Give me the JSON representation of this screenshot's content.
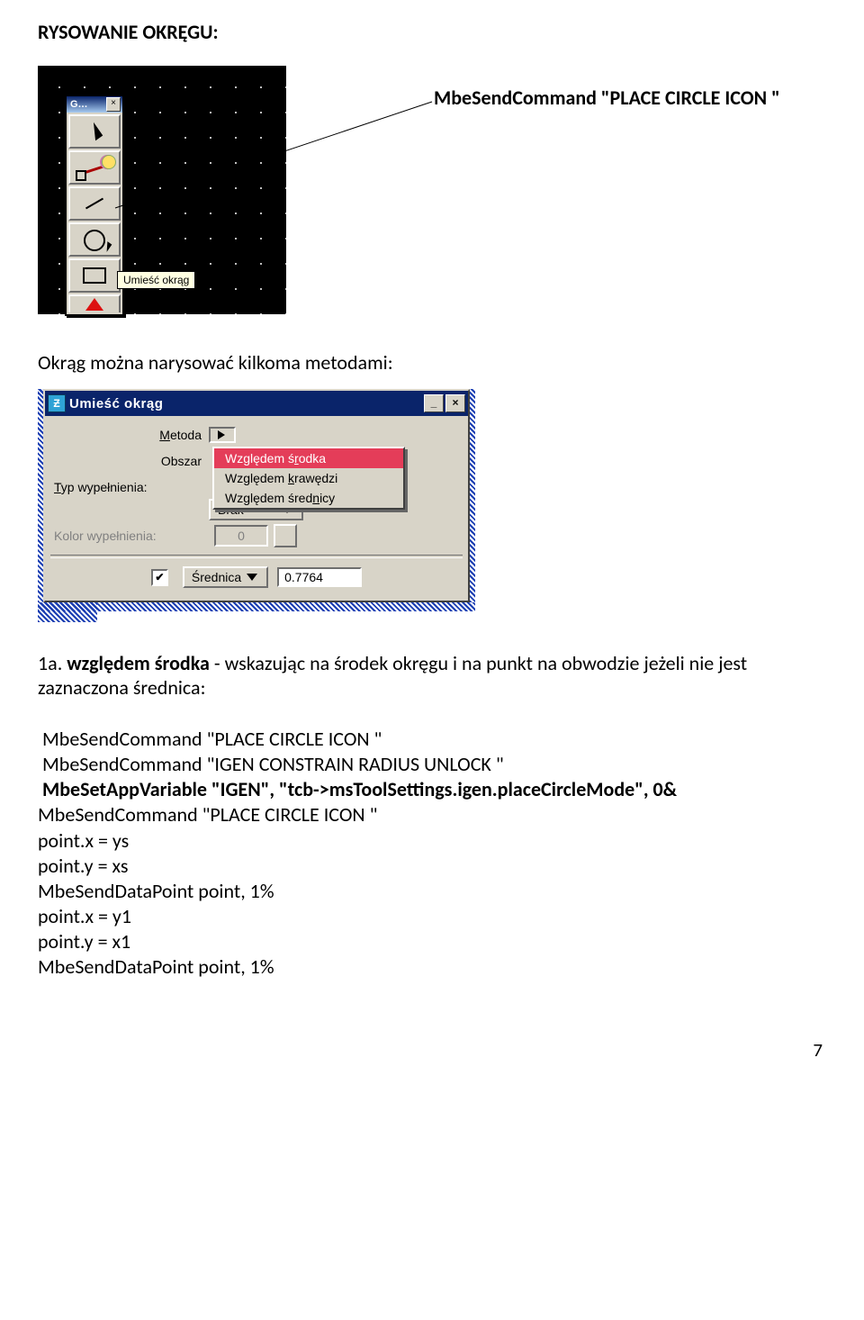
{
  "heading": "RYSOWANIE OKRĘGU:",
  "inline_cmd": "MbeSendCommand \"PLACE CIRCLE ICON \"",
  "toolbox": {
    "window_label": "G…",
    "close_glyph": "×",
    "tooltip": "Umieść okrąg"
  },
  "para_intro": "Okrąg można narysować kilkoma metodami:",
  "dialog": {
    "title": "Umieść okrąg",
    "icon_text": "Ƶ",
    "min_glyph": "_",
    "close_glyph": "×",
    "labels": {
      "metoda_pre": "M",
      "metoda_rest": "etoda",
      "obszar": "Obszar",
      "typwyp_pre": "T",
      "typwyp_rest": "yp wypełnienia:",
      "kolorwyp": "Kolor wypełnienia:",
      "srednica_pre": "Ś",
      "srednica_rest": "rednica"
    },
    "metoda_selected": "Względem środka",
    "menu": {
      "opt1_pre": "Względem ś",
      "opt1_ul": "r",
      "opt1_post": "odka",
      "opt2_pre": "Względem ",
      "opt2_ul": "k",
      "opt2_post": "rawędzi",
      "opt3_pre": "Względem śred",
      "opt3_ul": "n",
      "opt3_post": "icy"
    },
    "typwyp_value": "Brak",
    "kolor_value": "0",
    "srednica_value": "0.7764",
    "check_glyph": "✔"
  },
  "numbered": {
    "num": "1a. ",
    "bold": "względem środka",
    "rest": " - wskazując na środek okręgu i na punkt na obwodzie jeżeli nie jest zaznaczona średnica:"
  },
  "code": {
    "l1": " MbeSendCommand \"PLACE CIRCLE ICON \"",
    "l2": " MbeSendCommand \"IGEN CONSTRAIN RADIUS UNLOCK \"",
    "l3": " MbeSetAppVariable \"IGEN\", \"tcb->msToolSettings.igen.placeCircleMode\", 0&",
    "l4": "MbeSendCommand \"PLACE CIRCLE ICON \"",
    "l5": "point.x = ys",
    "l6": "point.y = xs",
    "l7": "MbeSendDataPoint point, 1%",
    "l8": "point.x = y1",
    "l9": "point.y = x1",
    "l10": "MbeSendDataPoint point, 1%"
  },
  "pagenum": "7"
}
